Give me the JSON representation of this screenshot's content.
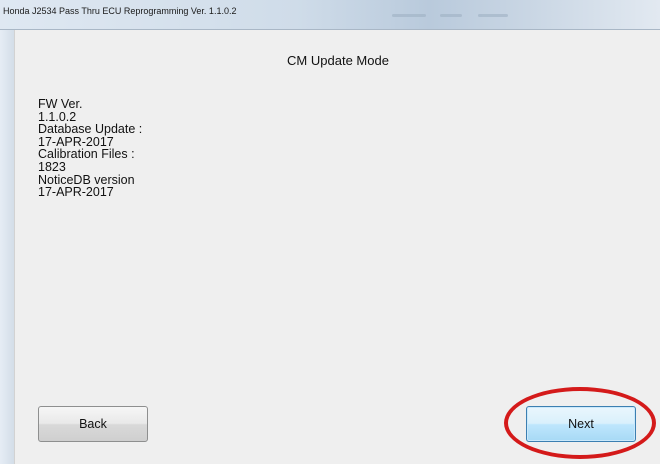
{
  "window": {
    "title": "Honda J2534 Pass Thru ECU Reprogramming Ver. 1.1.0.2"
  },
  "main": {
    "mode_title": "CM Update Mode",
    "info_lines": [
      "FW Ver.",
      "1.1.0.2",
      "Database Update :",
      "17-APR-2017",
      "Calibration Files :",
      "1823",
      "NoticeDB version",
      "17-APR-2017"
    ]
  },
  "buttons": {
    "back_label": "Back",
    "next_label": "Next"
  },
  "colors": {
    "highlight_ring": "#d41a1a",
    "client_background": "#efefef",
    "next_button_accent": "#bee6fd"
  }
}
